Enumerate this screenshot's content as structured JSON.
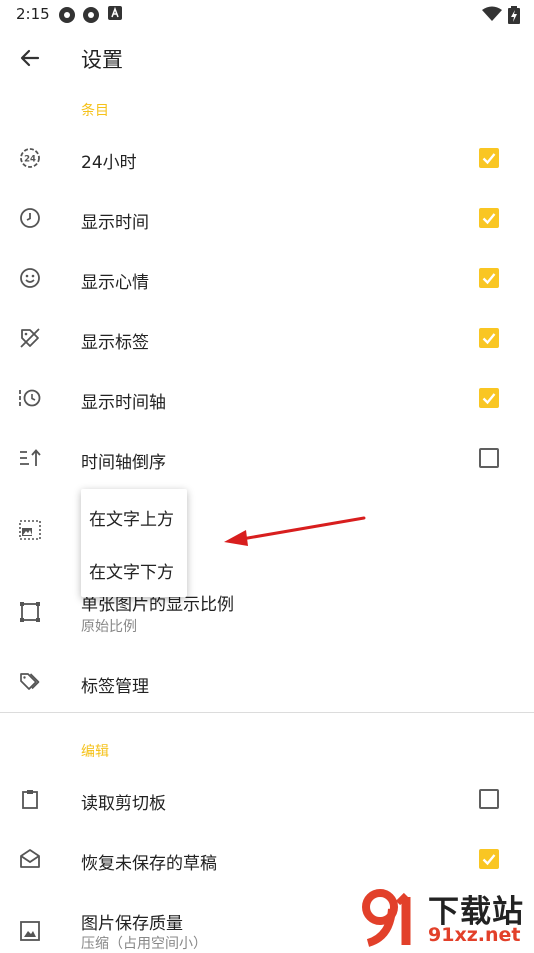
{
  "status_bar": {
    "time": "2:15"
  },
  "app_bar": {
    "title": "设置"
  },
  "sections": {
    "items_header": "条目",
    "edit_header": "编辑"
  },
  "rows": {
    "r24": {
      "label": "24小时",
      "checked": true
    },
    "show_time": {
      "label": "显示时间",
      "checked": true
    },
    "show_mood": {
      "label": "显示心情",
      "checked": true
    },
    "show_tags": {
      "label": "显示标签",
      "checked": true
    },
    "show_timeline": {
      "label": "显示时间轴",
      "checked": true
    },
    "timeline_reverse": {
      "label": "时间轴倒序",
      "checked": false
    },
    "single_ratio": {
      "label": "单张图片的显示比例",
      "sub": "原始比例"
    },
    "tag_manage": {
      "label": "标签管理"
    },
    "read_clipboard": {
      "label": "读取剪切板",
      "checked": false
    },
    "restore_draft": {
      "label": "恢复未保存的草稿",
      "checked": true
    },
    "image_quality": {
      "label": "图片保存质量",
      "sub": "压缩（占用空间小）"
    }
  },
  "popup": {
    "option_above": "在文字上方",
    "option_below": "在文字下方"
  },
  "watermark": {
    "brand": "下载站",
    "domain": "91xz.net"
  },
  "colors": {
    "accent": "#f9c623",
    "section": "#f5c21b",
    "arrow": "#d81e1e"
  }
}
